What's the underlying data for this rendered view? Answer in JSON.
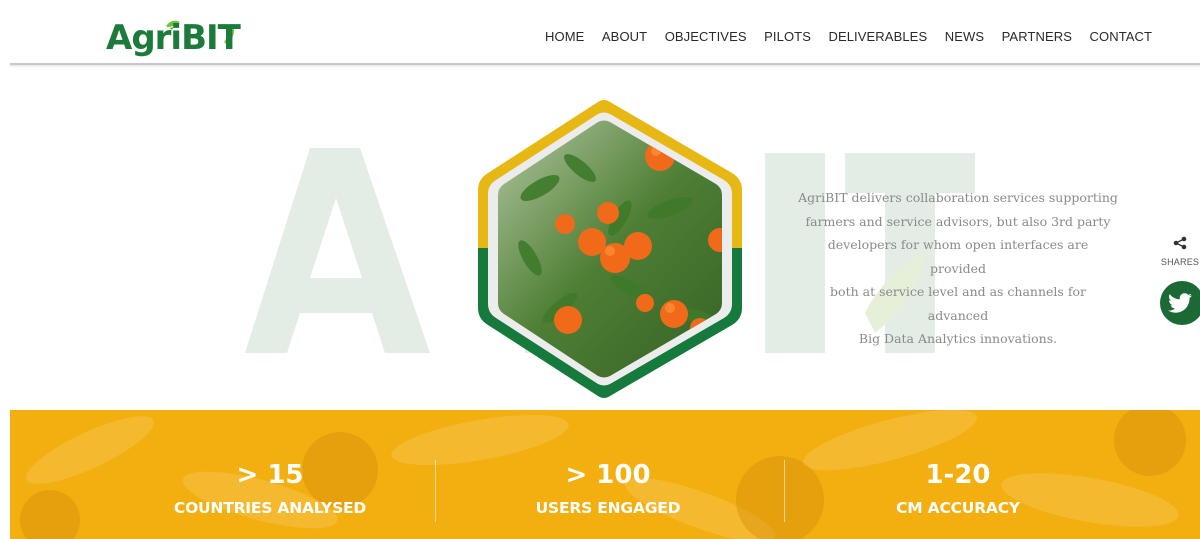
{
  "brand": {
    "logo_text_agri": "Agri",
    "logo_text_bit": "BIT"
  },
  "nav": {
    "items": [
      {
        "label": "HOME"
      },
      {
        "label": "ABOUT"
      },
      {
        "label": "OBJECTIVES"
      },
      {
        "label": "PILOTS"
      },
      {
        "label": "DELIVERABLES"
      },
      {
        "label": "NEWS"
      },
      {
        "label": "PARTNERS"
      },
      {
        "label": "CONTACT"
      }
    ]
  },
  "hero": {
    "description_lines": [
      "AgriBIT delivers collaboration services supporting",
      "farmers and service advisors, but also 3rd party",
      "developers for whom open interfaces are provided",
      "both at service level and as channels for advanced",
      "Big Data Analytics innovations."
    ],
    "watermark_text": "AgriBIT"
  },
  "share": {
    "label": "SHARES",
    "icon": "share-icon",
    "twitter_icon": "twitter-icon"
  },
  "stats": [
    {
      "value": "> 15",
      "label": "COUNTRIES ANALYSED"
    },
    {
      "value": "> 100",
      "label": "USERS ENGAGED"
    },
    {
      "value": "1-20",
      "label": "CM ACCURACY"
    }
  ],
  "colors": {
    "brand_green": "#1c7a3a",
    "brand_yellow": "#f2ae0e",
    "hex_gold": "#e7b713",
    "hex_green": "#157a3b"
  }
}
